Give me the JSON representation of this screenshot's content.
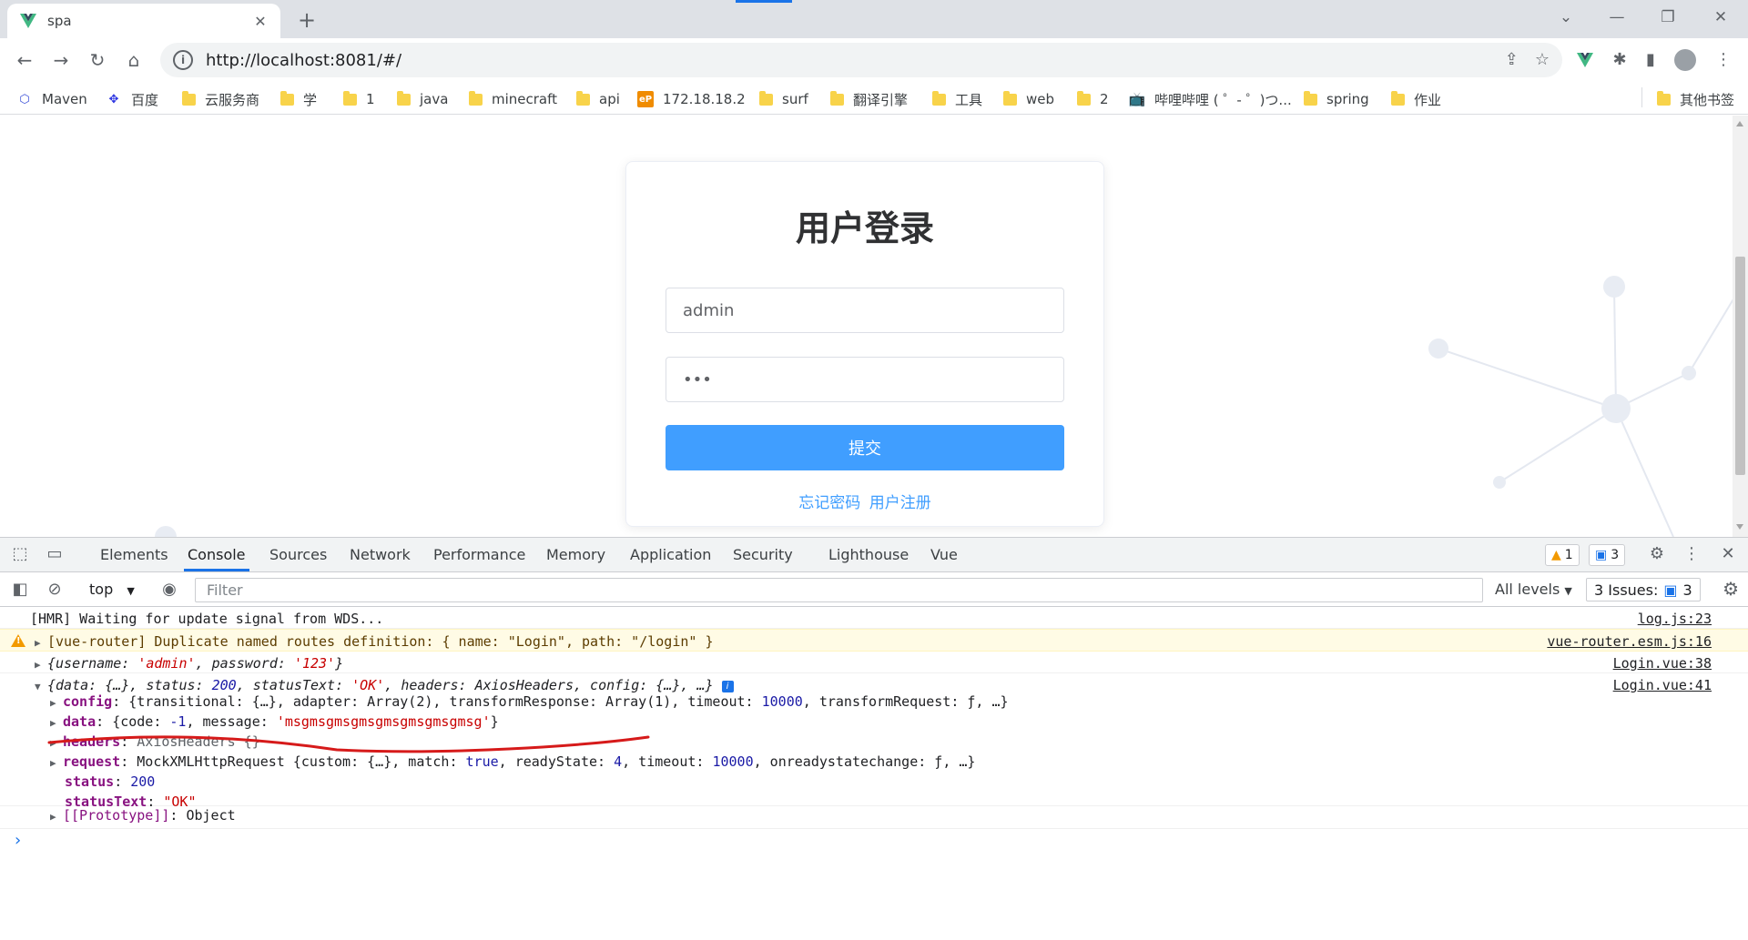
{
  "browser": {
    "tab_title": "spa",
    "url": "http://localhost:8081/#/",
    "bookmarks": [
      {
        "label": "Maven",
        "icon": "maven-icon"
      },
      {
        "label": "百度",
        "icon": "baidu-icon"
      },
      {
        "label": "云服务商",
        "icon": "folder-icon"
      },
      {
        "label": "学",
        "icon": "folder-icon"
      },
      {
        "label": "1",
        "icon": "folder-icon"
      },
      {
        "label": "java",
        "icon": "folder-icon"
      },
      {
        "label": "minecraft",
        "icon": "folder-icon"
      },
      {
        "label": "api",
        "icon": "folder-icon"
      },
      {
        "label": "172.18.18.2",
        "icon": "ep-icon"
      },
      {
        "label": "surf",
        "icon": "folder-icon"
      },
      {
        "label": "翻译引擎",
        "icon": "folder-icon"
      },
      {
        "label": "工具",
        "icon": "folder-icon"
      },
      {
        "label": "web",
        "icon": "folder-icon"
      },
      {
        "label": "2",
        "icon": "folder-icon"
      },
      {
        "label": "哔哩哔哩 ( ゜- ゜)つ...",
        "icon": "bilibili-icon"
      },
      {
        "label": "spring",
        "icon": "folder-icon"
      },
      {
        "label": "作业",
        "icon": "folder-icon"
      }
    ],
    "other_bookmarks": "其他书签"
  },
  "login": {
    "title": "用户登录",
    "username_value": "admin",
    "password_value": "•••",
    "submit_label": "提交",
    "forgot_link": "忘记密码",
    "register_link": "用户注册"
  },
  "devtools": {
    "tabs": [
      "Elements",
      "Console",
      "Sources",
      "Network",
      "Performance",
      "Memory",
      "Application",
      "Security",
      "Lighthouse",
      "Vue"
    ],
    "active_tab": "Console",
    "warning_count": "1",
    "message_count": "3",
    "context": "top",
    "filter_placeholder": "Filter",
    "levels": "All levels",
    "issues_label": "3 Issues:",
    "issues_count": "3"
  },
  "console": {
    "hmr": {
      "text": "[HMR] Waiting for update signal from WDS...",
      "source": "log.js:23"
    },
    "router_warn": {
      "text": "[vue-router] Duplicate named routes definition: { name: \"Login\", path: \"/login\" }",
      "source": "vue-router.esm.js:16"
    },
    "obj1": {
      "prefix": "{username: ",
      "username": "'admin'",
      "mid": ", password: ",
      "password": "'123'",
      "suffix": "}",
      "source": "Login.vue:38"
    },
    "obj2": {
      "summary_a": "{data: {…}, status: ",
      "status_val": "200",
      "summary_b": ", statusText: ",
      "status_text_val": "'OK'",
      "summary_c": ", headers: AxiosHeaders, config: {…}, …}",
      "source": "Login.vue:41",
      "config_key": "config",
      "config_val": "{transitional: {…}, adapter: Array(2), transformResponse: Array(1), timeout: ",
      "config_timeout": "10000",
      "config_tail": ", transformRequest: ƒ, …}",
      "data_key": "data",
      "data_a": "{code: ",
      "data_code": "-1",
      "data_b": ", message: ",
      "data_msg": "'msgmsgmsgmsgmsgmsgmsgmsg'",
      "data_c": "}",
      "headers_key": "headers",
      "headers_val": "AxiosHeaders {}",
      "request_key": "request",
      "request_a": "MockXMLHttpRequest {custom: {…}, match: ",
      "request_match": "true",
      "request_b": ", readyState: ",
      "request_ready": "4",
      "request_c": ", timeout: ",
      "request_timeout": "10000",
      "request_d": ", onreadystatechange: ƒ, …}",
      "status_key": "status",
      "status_value": "200",
      "statustext_key": "statusText",
      "statustext_value": "\"OK\"",
      "proto_key": "[[Prototype]]",
      "proto_val": "Object"
    }
  },
  "colors": {
    "accent": "#409eff",
    "devtools_active": "#1a73e8",
    "annotation": "#d61a1a",
    "warning": "#f29900"
  }
}
